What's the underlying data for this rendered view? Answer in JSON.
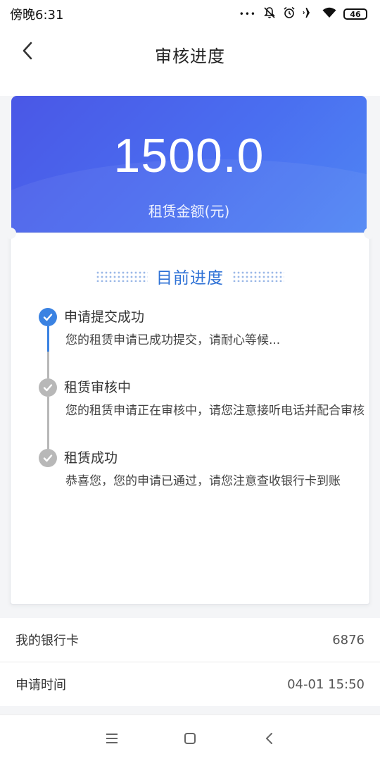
{
  "status_bar": {
    "time": "傍晚6:31",
    "icons": [
      "more-dots-icon",
      "bell-off-icon",
      "alarm-icon",
      "airplane-icon",
      "wifi-icon",
      "battery-icon"
    ],
    "dots": "•••",
    "battery": "46"
  },
  "header": {
    "title": "审核进度"
  },
  "amount_card": {
    "amount": "1500.0",
    "label": "租赁金额(元)",
    "colors": {
      "start": "#4a57e6",
      "end": "#4f86f4"
    }
  },
  "progress": {
    "title": "目前进度",
    "accent": "#2f72d6",
    "steps": [
      {
        "title": "申请提交成功",
        "desc": "您的租赁申请已成功提交，请耐心等候...",
        "status": "done"
      },
      {
        "title": "租赁审核中",
        "desc": "您的租赁申请正在审核中，请您注意接听电话并配合审核",
        "status": "pending"
      },
      {
        "title": "租赁成功",
        "desc": "恭喜您，您的申请已通过，请您注意查收银行卡到账",
        "status": "pending"
      }
    ]
  },
  "info": {
    "bank_card_label": "我的银行卡",
    "bank_card_value": "6876",
    "apply_time_label": "申请时间",
    "apply_time_value": "04-01 15:50"
  },
  "nav_bar": {
    "icons": [
      "menu-icon",
      "home-square-icon",
      "back-chevron-icon"
    ]
  }
}
